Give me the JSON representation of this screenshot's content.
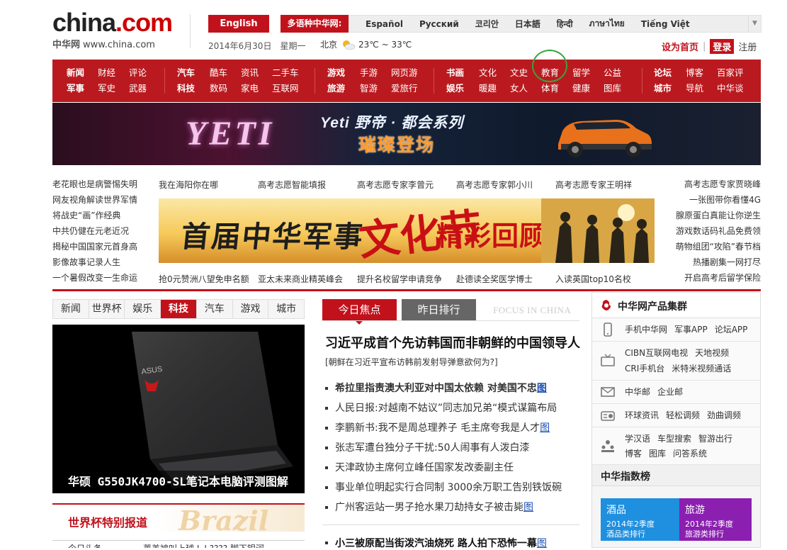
{
  "header": {
    "logo_main": "china",
    "logo_dot": ".",
    "logo_com": "com",
    "logo_cn": "中华网",
    "logo_url": "www.china.com",
    "english_label": "English",
    "multilang_label": "多语种中华网:",
    "languages": [
      "Español",
      "Русский",
      "코리안",
      "日本語",
      "हिन्दी",
      "ภาษาไทย",
      "Tiếng Việt"
    ],
    "date": "2014年6月30日",
    "weekday": "星期一",
    "city": "北京",
    "temperature": "23℃ ~ 33℃",
    "set_home": "设为首页",
    "login": "登录",
    "register": "注册"
  },
  "nav": {
    "groups": [
      {
        "row1": [
          "新闻",
          "财经",
          "评论"
        ],
        "row2": [
          "军事",
          "军史",
          "武器"
        ]
      },
      {
        "row1": [
          "汽车",
          "酷车",
          "资讯",
          "二手车"
        ],
        "row2": [
          "科技",
          "数码",
          "家电",
          "互联网"
        ]
      },
      {
        "row1": [
          "游戏",
          "手游",
          "网页游"
        ],
        "row2": [
          "旅游",
          "智游",
          "爱旅行"
        ]
      },
      {
        "row1": [
          "书画",
          "文化",
          "文史",
          "教育",
          "留学",
          "公益"
        ],
        "row2": [
          "娱乐",
          "暖趣",
          "女人",
          "体育",
          "健康",
          "图库"
        ]
      },
      {
        "row1": [
          "论坛",
          "博客",
          "百家评"
        ],
        "row2": [
          "城市",
          "导航",
          "中华谈"
        ]
      }
    ]
  },
  "banner": {
    "big_text": "YETI",
    "title": "Yeti 野帝 · 都会系列",
    "subtitle": "璀璨登场"
  },
  "promo": {
    "left": [
      "老花眼也是病警惕失明",
      "网友视角解读世界军情",
      "将战史“画”作经典",
      "中共仍健在元老近况",
      "揭秘中国国家元首身高",
      "影像故事记录人生",
      "一个暑假改变一生命运"
    ],
    "right": [
      "高考志愿专家贾晓峰",
      "一张图带你看懂4G",
      "腺原蛋白真能让你逆生",
      "游戏数话码礼品免费领",
      "萌物组团“攻陷”春节档",
      "热播剧集一网打尽",
      "开启高考后留学保险"
    ],
    "top": [
      "我在海阳你在哪",
      "高考志愿智能填报",
      "高考志愿专家李曾元",
      "高考志愿专家郭小川",
      "高考志愿专家王明祥"
    ],
    "bottom": [
      "抢0元赞洲八望免申名额",
      "亚太未来商业精英峰会",
      "提升名校留学申请竞争",
      "赴德读全奖医学博士",
      "入读英国top10名校"
    ],
    "military_a": "首届中华军事",
    "military_b": "文化节",
    "military_c": "精彩回顾"
  },
  "left_tabs": [
    "新闻",
    "世界杯",
    "娱乐",
    "科技",
    "汽车",
    "游戏",
    "城市"
  ],
  "left_tab_active": 3,
  "laptop_caption": "华硕 G550JK4700-SL笔记本电脑评测图解",
  "laptop_brand": "ASUS",
  "worldcup": {
    "title": "世界杯特别报道",
    "deco": "Brazil"
  },
  "left_bottom": [
    "今日头条",
    "莱美被叫上球 L J   ???? 脚下银河"
  ],
  "center": {
    "tab_today": "今日焦点",
    "tab_yesterday": "昨日排行",
    "focus_en": "FOCUS IN CHINA",
    "headline": "习近平成首个先访韩国而非朝鲜的中国领导人",
    "subhead": "[朝鲜在习近平宣布访韩前发射导弹意欲何为?]",
    "news": [
      {
        "text": "希拉里指责澳大利亚对中国太依赖  对美国不忠",
        "tag": "图",
        "bold": true
      },
      {
        "text": "人民日报:对越南不姑议”同志加兄弟“模式谋篇布局",
        "tag": "",
        "bold": false
      },
      {
        "text": "李鹏新书:我不是周总理养子  毛主席夸我是人才",
        "tag": "图",
        "bold": false
      },
      {
        "text": "张志军遭台独分子干扰:50人闹事有人泼白漆",
        "tag": "",
        "bold": false
      },
      {
        "text": "天津政协主席何立峰任国家发改委副主任",
        "tag": "",
        "bold": false
      },
      {
        "text": "事业单位明起实行合同制  3000余万职工告别铁饭碗",
        "tag": "",
        "bold": false
      },
      {
        "text": "广州客运站一男子抢水果刀劫持女子被击毙",
        "tag": "图",
        "bold": false
      }
    ],
    "last_news": "小三被原配当街泼汽油烧死  路人拍下恐怖一幕",
    "last_tag": "图"
  },
  "right_panel": {
    "title": "中华网产品集群",
    "rows": [
      {
        "icon": "mobile-icon",
        "links": [
          "手机中华网",
          "军事APP",
          "论坛APP"
        ]
      },
      {
        "icon": "tv-icon",
        "links": [
          "CIBN互联网电视",
          "天地视频"
        ],
        "links2": [
          "CRI手机台",
          "米特米视频通话"
        ]
      },
      {
        "icon": "mail-icon",
        "links": [
          "中华邮",
          "企业邮"
        ]
      },
      {
        "icon": "radio-icon",
        "links": [
          "环球资讯",
          "轻松调频",
          "劲曲调频"
        ]
      },
      {
        "icon": "users-icon",
        "links": [
          "学汉语",
          "车型搜索",
          "智游出行"
        ],
        "links2": [
          "博客",
          "图库",
          "问答系统"
        ]
      }
    ],
    "index_title": "中华指数榜",
    "tiles": [
      {
        "head": "酒品",
        "s1": "2014年2季度",
        "s2": "酒品类排行",
        "color": "#1f8fdf"
      },
      {
        "head": "旅游",
        "s1": "2014年2季度",
        "s2": "旅游类排行",
        "color": "#8b1fb0"
      }
    ]
  },
  "colors": {
    "brand_red": "#c1121c",
    "nav_red": "#ba1a1f",
    "highlight_circle": "#3aa33a"
  }
}
